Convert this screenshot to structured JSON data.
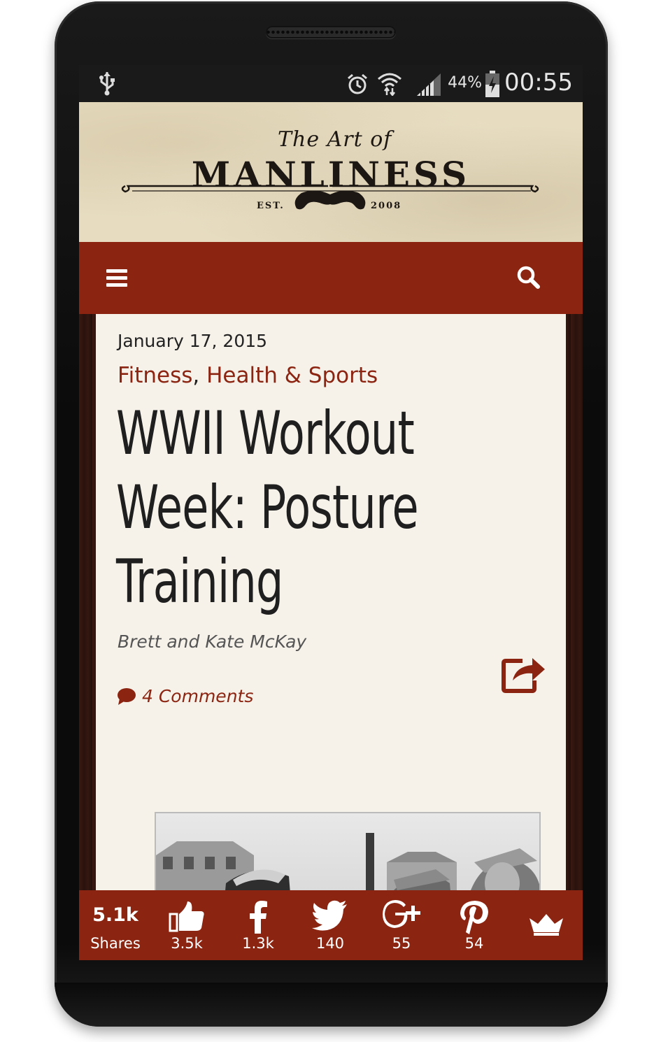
{
  "status_bar": {
    "battery_percent": "44%",
    "time": "00:55",
    "icons": [
      "usb-icon",
      "alarm-icon",
      "wifi-icon",
      "signal-icon",
      "battery-icon"
    ]
  },
  "header": {
    "logo_top": "The Art of",
    "logo_main": "MANLINESS",
    "logo_est": "EST.",
    "logo_year": "2008"
  },
  "navbar": {
    "icons": [
      "menu-icon",
      "search-icon"
    ]
  },
  "post": {
    "date": "January 17, 2015",
    "category_1": "Fitness",
    "separator": ",",
    "category_2": "Health & Sports",
    "title": "WWII Workout Week: Posture Training",
    "title_lines": [
      "WWII Workout",
      "Week: Posture",
      "Training"
    ],
    "author": "Brett and Kate McKay",
    "comments": "4 Comments"
  },
  "share_bar": {
    "total": "5.1k",
    "total_label": "Shares",
    "items": [
      {
        "icon": "thumbs-up-icon",
        "count": "3.5k"
      },
      {
        "icon": "facebook-icon",
        "count": "1.3k"
      },
      {
        "icon": "twitter-icon",
        "count": "140"
      },
      {
        "icon": "google-plus-icon",
        "count": "55"
      },
      {
        "icon": "pinterest-icon",
        "count": "54"
      },
      {
        "icon": "crown-icon",
        "count": ""
      }
    ]
  },
  "colors": {
    "brand_red": "#8b2512",
    "parchment": "#e7dcc0",
    "card_bg": "#f6f2ea",
    "status_bar": "#1a1a1a"
  }
}
